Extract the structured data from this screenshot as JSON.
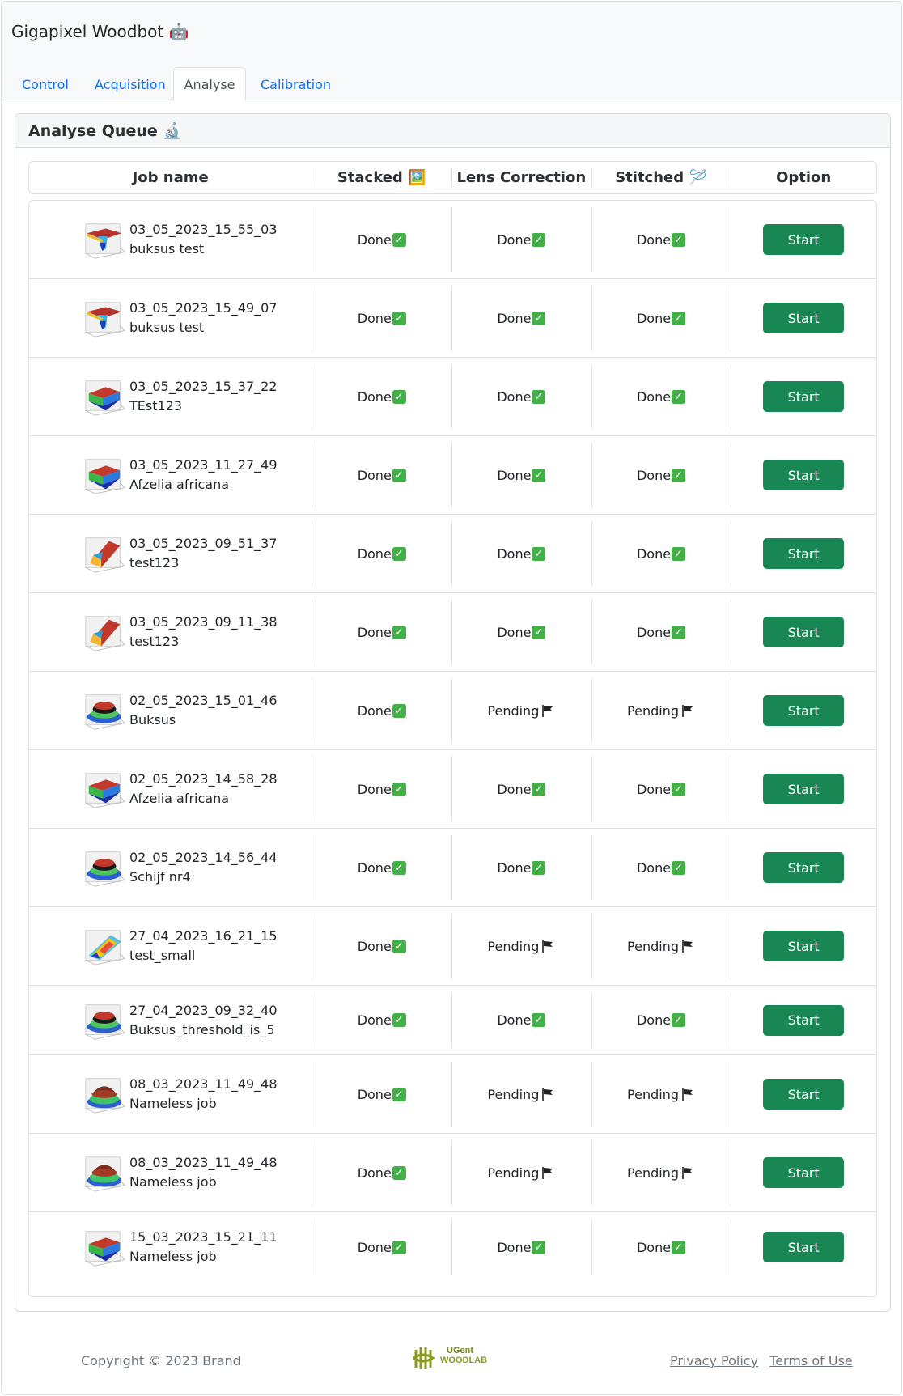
{
  "app": {
    "brand": "Gigapixel Woodbot 🤖"
  },
  "tabs": [
    {
      "label": "Control"
    },
    {
      "label": "Acquisition"
    },
    {
      "label": "Analyse",
      "active": true
    },
    {
      "label": "Calibration"
    }
  ],
  "card": {
    "title": "Analyse Queue 🔬"
  },
  "table": {
    "headers": [
      "Job name",
      "Stacked 🖼️",
      "Lens Correction",
      "Stitched 🪡",
      "Option"
    ],
    "rows": [
      {
        "date": "03_05_2023_15_55_03",
        "name": "buksus test",
        "stacked": "Done",
        "lens": "Done",
        "stitched": "Done",
        "action": "Start",
        "thumb": "pit"
      },
      {
        "date": "03_05_2023_15_49_07",
        "name": "buksus test",
        "stacked": "Done",
        "lens": "Done",
        "stitched": "Done",
        "action": "Start",
        "thumb": "pit"
      },
      {
        "date": "03_05_2023_15_37_22",
        "name": "TEst123",
        "stacked": "Done",
        "lens": "Done",
        "stitched": "Done",
        "action": "Start",
        "thumb": "block"
      },
      {
        "date": "03_05_2023_11_27_49",
        "name": "Afzelia africana",
        "stacked": "Done",
        "lens": "Done",
        "stitched": "Done",
        "action": "Start",
        "thumb": "block"
      },
      {
        "date": "03_05_2023_09_51_37",
        "name": "test123",
        "stacked": "Done",
        "lens": "Done",
        "stitched": "Done",
        "action": "Start",
        "thumb": "slope"
      },
      {
        "date": "03_05_2023_09_11_38",
        "name": "test123",
        "stacked": "Done",
        "lens": "Done",
        "stitched": "Done",
        "action": "Start",
        "thumb": "slope"
      },
      {
        "date": "02_05_2023_15_01_46",
        "name": "Buksus",
        "stacked": "Done",
        "lens": "Pending",
        "stitched": "Pending",
        "action": "Start",
        "thumb": "disk"
      },
      {
        "date": "02_05_2023_14_58_28",
        "name": "Afzelia africana",
        "stacked": "Done",
        "lens": "Done",
        "stitched": "Done",
        "action": "Start",
        "thumb": "block"
      },
      {
        "date": "02_05_2023_14_56_44",
        "name": "Schijf nr4",
        "stacked": "Done",
        "lens": "Done",
        "stitched": "Done",
        "action": "Start",
        "thumb": "disk"
      },
      {
        "date": "27_04_2023_16_21_15",
        "name": "test_small",
        "stacked": "Done",
        "lens": "Pending",
        "stitched": "Pending",
        "action": "Start",
        "thumb": "plane"
      },
      {
        "date": "27_04_2023_09_32_40",
        "name": "Buksus_threshold_is_5",
        "stacked": "Done",
        "lens": "Done",
        "stitched": "Done",
        "action": "Start",
        "thumb": "disk"
      },
      {
        "date": "08_03_2023_11_49_48",
        "name": "Nameless job",
        "stacked": "Done",
        "lens": "Pending",
        "stitched": "Pending",
        "action": "Start",
        "thumb": "dome"
      },
      {
        "date": "08_03_2023_11_49_48",
        "name": "Nameless job",
        "stacked": "Done",
        "lens": "Pending",
        "stitched": "Pending",
        "action": "Start",
        "thumb": "dome"
      },
      {
        "date": "15_03_2023_15_21_11",
        "name": "Nameless job",
        "stacked": "Done",
        "lens": "Done",
        "stitched": "Done",
        "action": "Start",
        "thumb": "block"
      }
    ]
  },
  "footer": {
    "copyright": "Copyright © 2023 Brand",
    "logo_text": [
      "UGent",
      "WOODLAB"
    ],
    "links": [
      "Privacy Policy",
      "Terms of Use"
    ]
  },
  "colors": {
    "primary": "#0d6efd",
    "success": "#198754",
    "done": "#43b047",
    "logo": "#8a9a1c"
  },
  "icons": {
    "done": "check-mark-icon",
    "pending": "flag-icon",
    "thumb": "surface-plot-thumbnail"
  }
}
